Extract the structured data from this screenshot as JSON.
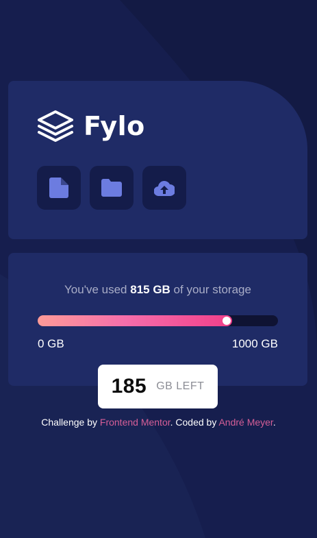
{
  "brand": {
    "name": "Fylo"
  },
  "tools": [
    {
      "icon": "document-icon"
    },
    {
      "icon": "folder-icon"
    },
    {
      "icon": "upload-icon"
    }
  ],
  "usage": {
    "prefix": "You've used ",
    "used": "815 GB",
    "suffix": " of your storage",
    "used_gb": 815,
    "total_gb": 1000,
    "scale_min": "0 GB",
    "scale_max": "1000 GB"
  },
  "remaining": {
    "value": "185",
    "unit": "GB LEFT"
  },
  "footer": {
    "challenge_prefix": "Challenge by ",
    "challenge_link": "Frontend Mentor",
    "coded_prefix": ". Coded by ",
    "author_link": "André Meyer",
    "end": "."
  },
  "colors": {
    "background": "#151d47",
    "card": "#1f2b66",
    "tool_button": "#141c4a",
    "tool_icon": "#6c7ce0",
    "bar_gradient_start": "#fd9b98",
    "bar_gradient_end": "#f03f8a",
    "link": "#d55e97"
  }
}
